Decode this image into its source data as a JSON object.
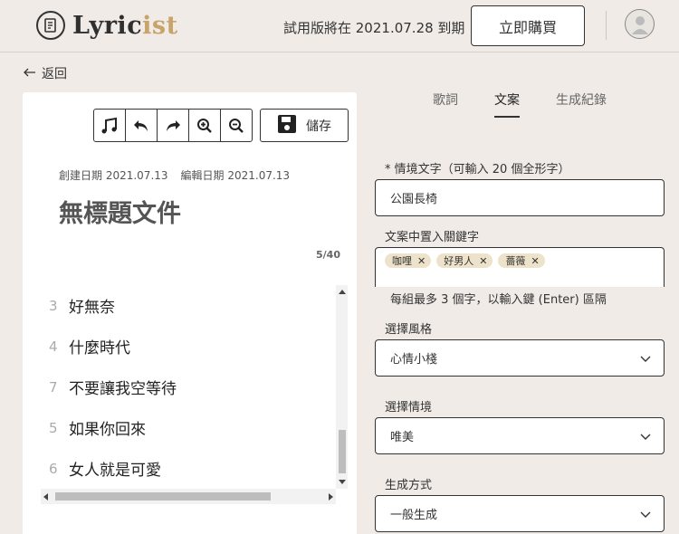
{
  "app": {
    "logo_main": "Lyric",
    "logo_accent": "ist"
  },
  "header": {
    "trial_notice": "試用版將在 2021.07.28 到期",
    "buy_label": "立即購買",
    "avatar_icon": "user-avatar-icon"
  },
  "nav": {
    "back_label": "返回"
  },
  "editor": {
    "toolbar": {
      "icons": [
        "music-note-icon",
        "undo-icon",
        "redo-icon",
        "zoom-in-icon",
        "zoom-out-icon"
      ],
      "save_label": "儲存"
    },
    "created": "創建日期 2021.07.13",
    "edited": "編輯日期 2021.07.13",
    "title": "無標題文件",
    "count": "5/40",
    "lines": [
      {
        "num": "3",
        "text": "好無奈"
      },
      {
        "num": "4",
        "text": "什麼時代"
      },
      {
        "num": "7",
        "text": "不要讓我空等待"
      },
      {
        "num": "5",
        "text": "如果你回來"
      },
      {
        "num": "6",
        "text": "女人就是可愛"
      }
    ]
  },
  "tabs": [
    {
      "label": "歌詞",
      "active": false
    },
    {
      "label": "文案",
      "active": true
    },
    {
      "label": "生成紀錄",
      "active": false
    }
  ],
  "form": {
    "scene_label": "* 情境文字（可輸入 20 個全形字）",
    "scene_value": "公園長椅",
    "keywords_label": "文案中置入關鍵字",
    "keywords": [
      "咖哩",
      "好男人",
      "薔薇"
    ],
    "keywords_hint": "每組最多 3 個字，以輸入鍵 (Enter) 區隔",
    "style_label": "選擇風格",
    "style_value": "心情小棧",
    "mood_label": "選擇情境",
    "mood_value": "唯美",
    "method_label": "生成方式",
    "method_value": "一般生成"
  },
  "colors": {
    "background": "#f0ebe7",
    "accent": "#c8a46a",
    "tag_bg": "#ede3cb"
  }
}
